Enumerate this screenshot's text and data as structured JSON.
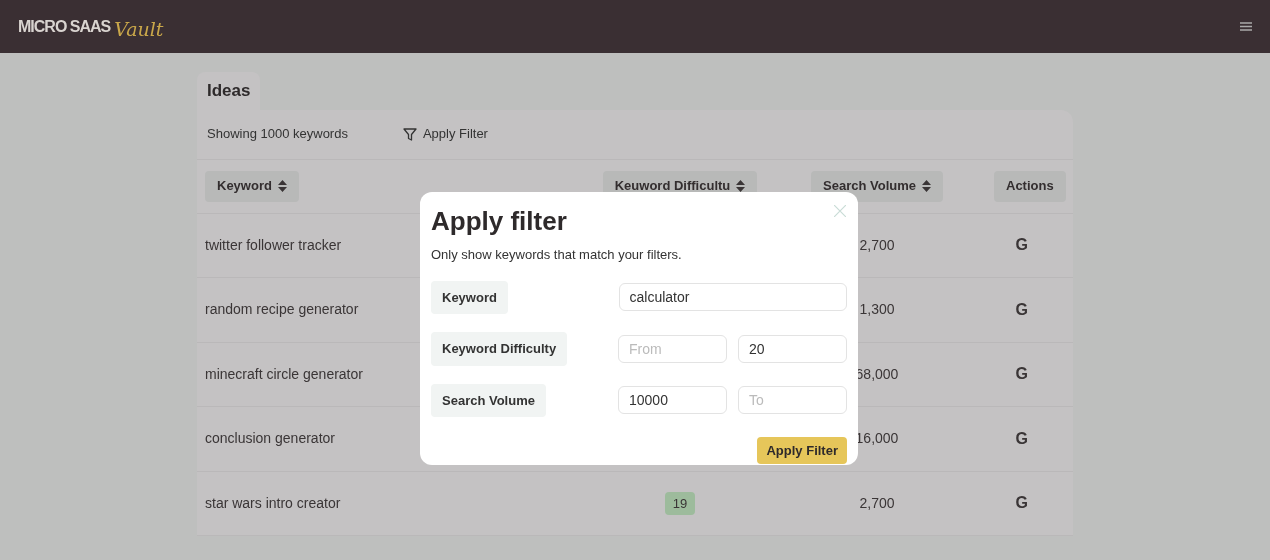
{
  "header": {
    "logo_text": "MICRO SAAS",
    "logo_script": "Vault"
  },
  "tab": {
    "label": "Ideas"
  },
  "toolbar": {
    "count": "Showing 1000 keywords",
    "filter_button": "Apply Filter"
  },
  "table": {
    "columns": [
      {
        "label": "Keyword",
        "sortable": true
      },
      {
        "label": "Keuword Difficultu",
        "sortable": true
      },
      {
        "label": "Search Volume",
        "sortable": true
      },
      {
        "label": "Actions",
        "sortable": false
      }
    ],
    "rows": [
      {
        "keyword": "twitter follower tracker",
        "volume": "2,700",
        "action": "G"
      },
      {
        "keyword": "random recipe generator",
        "volume": "1,300",
        "action": "G"
      },
      {
        "keyword": "minecraft circle generator",
        "volume": "68,000",
        "action": "G"
      },
      {
        "keyword": "conclusion generator",
        "volume": "16,000",
        "action": "G"
      },
      {
        "keyword": "star wars intro creator",
        "difficulty": "19",
        "volume": "2,700",
        "action": "G"
      }
    ]
  },
  "modal": {
    "title": "Apply filter",
    "description": "Only show keywords that match your filters.",
    "fields": [
      {
        "kind": "single",
        "label": "Keyword",
        "value": "calculator"
      },
      {
        "kind": "range",
        "label": "Keyword Difficulty",
        "from": {
          "placeholder": "From"
        },
        "to": {
          "value": "20"
        }
      },
      {
        "kind": "range",
        "label": "Search Volume",
        "from": {
          "value": "10000"
        },
        "to": {
          "placeholder": "To"
        }
      }
    ],
    "button": "Apply Filter"
  }
}
